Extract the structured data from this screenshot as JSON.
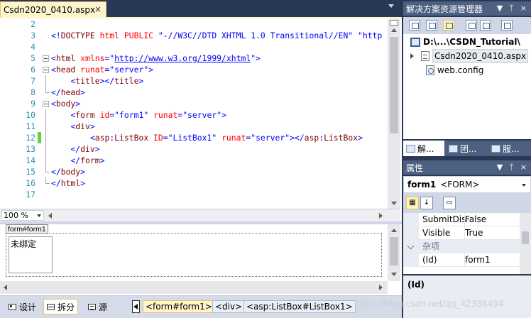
{
  "editor": {
    "tab_title": "Csdn2020_0410.aspx",
    "tab_close": "×",
    "zoom": "100 %",
    "lines": [
      {
        "num": "2",
        "parts": []
      },
      {
        "num": "3",
        "parts": [
          {
            "c": "c-blue",
            "t": "<!"
          },
          {
            "c": "c-tag",
            "t": "DOCTYPE "
          },
          {
            "c": "c-attr",
            "t": "html PUBLIC "
          },
          {
            "c": "c-blue",
            "t": "\"-//W3C//DTD XHTML 1.0 Transitional//EN\" \"http"
          }
        ]
      },
      {
        "num": "4",
        "parts": []
      },
      {
        "num": "5",
        "parts": [
          {
            "c": "c-blue",
            "t": "<"
          },
          {
            "c": "c-tag",
            "t": "html "
          },
          {
            "c": "c-attr",
            "t": "xmlns"
          },
          {
            "c": "c-blue",
            "t": "=\""
          },
          {
            "c": "c-link",
            "t": "http://www.w3.org/1999/xhtml"
          },
          {
            "c": "c-blue",
            "t": "\">"
          }
        ]
      },
      {
        "num": "6",
        "parts": [
          {
            "c": "c-blue",
            "t": "<"
          },
          {
            "c": "c-tag",
            "t": "head "
          },
          {
            "c": "c-attr",
            "t": "runat"
          },
          {
            "c": "c-blue",
            "t": "=\"server\">"
          }
        ]
      },
      {
        "num": "7",
        "parts": [
          {
            "c": "c-text",
            "t": "    "
          },
          {
            "c": "c-blue",
            "t": "<"
          },
          {
            "c": "c-tag",
            "t": "title"
          },
          {
            "c": "c-blue",
            "t": "></"
          },
          {
            "c": "c-tag",
            "t": "title"
          },
          {
            "c": "c-blue",
            "t": ">"
          }
        ]
      },
      {
        "num": "8",
        "parts": [
          {
            "c": "c-blue",
            "t": "</"
          },
          {
            "c": "c-tag",
            "t": "head"
          },
          {
            "c": "c-blue",
            "t": ">"
          }
        ]
      },
      {
        "num": "9",
        "parts": [
          {
            "c": "c-blue",
            "t": "<"
          },
          {
            "c": "c-tag",
            "t": "body"
          },
          {
            "c": "c-blue",
            "t": ">"
          }
        ]
      },
      {
        "num": "10",
        "parts": [
          {
            "c": "c-text",
            "t": "    "
          },
          {
            "c": "c-blue",
            "t": "<"
          },
          {
            "c": "c-tag",
            "t": "form "
          },
          {
            "c": "c-attr",
            "t": "id"
          },
          {
            "c": "c-blue",
            "t": "=\"form1\" "
          },
          {
            "c": "c-attr",
            "t": "runat"
          },
          {
            "c": "c-blue",
            "t": "=\"server\">"
          }
        ]
      },
      {
        "num": "11",
        "parts": [
          {
            "c": "c-text",
            "t": "    "
          },
          {
            "c": "c-blue",
            "t": "<"
          },
          {
            "c": "c-tag",
            "t": "div"
          },
          {
            "c": "c-blue",
            "t": ">"
          }
        ]
      },
      {
        "num": "12",
        "parts": [
          {
            "c": "c-text",
            "t": "        "
          },
          {
            "c": "c-blue",
            "t": "<"
          },
          {
            "c": "c-tag",
            "t": "asp"
          },
          {
            "c": "c-blue",
            "t": ":"
          },
          {
            "c": "c-tag",
            "t": "ListBox "
          },
          {
            "c": "c-attr",
            "t": "ID"
          },
          {
            "c": "c-blue",
            "t": "=\"ListBox1\" "
          },
          {
            "c": "c-attr",
            "t": "runat"
          },
          {
            "c": "c-blue",
            "t": "=\"server\"></"
          },
          {
            "c": "c-tag",
            "t": "asp"
          },
          {
            "c": "c-blue",
            "t": ":"
          },
          {
            "c": "c-tag",
            "t": "ListBox"
          },
          {
            "c": "c-blue",
            "t": ">"
          }
        ]
      },
      {
        "num": "13",
        "parts": [
          {
            "c": "c-text",
            "t": "    "
          },
          {
            "c": "c-blue",
            "t": "</"
          },
          {
            "c": "c-tag",
            "t": "div"
          },
          {
            "c": "c-blue",
            "t": ">"
          }
        ]
      },
      {
        "num": "14",
        "parts": [
          {
            "c": "c-text",
            "t": "    "
          },
          {
            "c": "c-blue",
            "t": "</"
          },
          {
            "c": "c-tag",
            "t": "form"
          },
          {
            "c": "c-blue",
            "t": ">"
          }
        ]
      },
      {
        "num": "15",
        "parts": [
          {
            "c": "c-blue",
            "t": "</"
          },
          {
            "c": "c-tag",
            "t": "body"
          },
          {
            "c": "c-blue",
            "t": ">"
          }
        ]
      },
      {
        "num": "16",
        "parts": [
          {
            "c": "c-blue",
            "t": "</"
          },
          {
            "c": "c-tag",
            "t": "html"
          },
          {
            "c": "c-blue",
            "t": ">"
          }
        ]
      },
      {
        "num": "17",
        "parts": []
      }
    ]
  },
  "design": {
    "selection_label": "form#form1",
    "listbox_text": "未绑定"
  },
  "viewbar": {
    "design_label": "设计",
    "split_label": "拆分",
    "source_label": "源",
    "breadcrumbs": [
      "<form#form1>",
      "<div>",
      "<asp:ListBox#ListBox1>"
    ]
  },
  "solution_explorer": {
    "title": "解决方案资源管理器",
    "project": "D:\\...\\CSDN_Tutorial\\",
    "items": [
      "Csdn2020_0410.aspx",
      "web.config"
    ],
    "tabs": [
      "解...",
      "团...",
      "服..."
    ]
  },
  "properties": {
    "title": "属性",
    "object_name": "form1",
    "object_type": "<FORM>",
    "rows": [
      {
        "name": "SubmitDis",
        "value": "False"
      },
      {
        "name": "Visible",
        "value": "True"
      },
      {
        "category": "杂项"
      },
      {
        "name": "(Id)",
        "value": "form1"
      }
    ],
    "description": "(Id)"
  },
  "watermark": "https://blog.csdn.net/qq_42386494",
  "panel_controls": {
    "dropdown": "▼",
    "pin": "ᛘ",
    "close": "×"
  }
}
